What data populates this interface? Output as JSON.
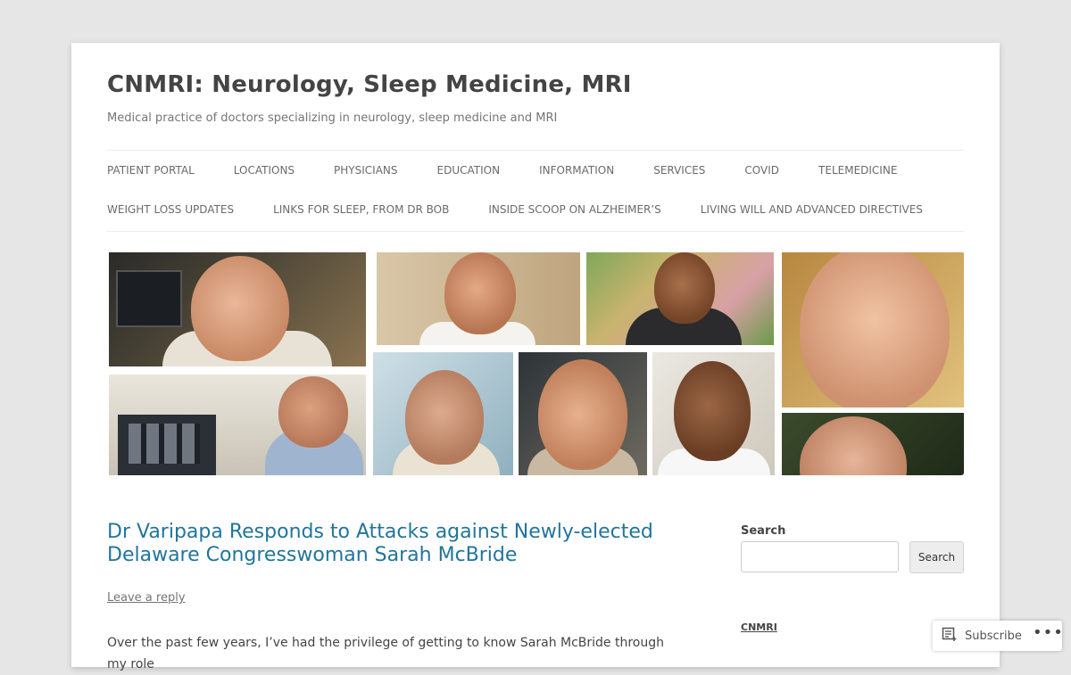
{
  "site": {
    "title": "CNMRI: Neurology, Sleep Medicine, MRI",
    "description": "Medical practice of doctors specializing in neurology, sleep medicine and MRI"
  },
  "nav": {
    "row1": [
      "PATIENT PORTAL",
      "LOCATIONS",
      "PHYSICIANS",
      "EDUCATION",
      "INFORMATION",
      "SERVICES",
      "COVID",
      "TELEMEDICINE"
    ],
    "row2": [
      "WEIGHT LOSS UPDATES",
      "LINKS FOR SLEEP, FROM DR BOB",
      "INSIDE SCOOP ON ALZHEIMER’S",
      "LIVING WILL AND ADVANCED DIRECTIVES"
    ]
  },
  "post": {
    "title": "Dr Varipapa Responds to Attacks against Newly-elected Delaware Congresswoman Sarah McBride",
    "reply_label": "Leave a reply",
    "body": "Over the past few years, I’ve had the privilege of getting to know Sarah McBride through my role"
  },
  "sidebar": {
    "search_title": "Search",
    "search_placeholder": "",
    "search_button": "Search",
    "link_label": "CNMRI"
  },
  "footer_bar": {
    "subscribe_label": "Subscribe",
    "more_label": "•••"
  },
  "colors": {
    "link": "#21759b",
    "page_bg": "#e6e6e6"
  }
}
